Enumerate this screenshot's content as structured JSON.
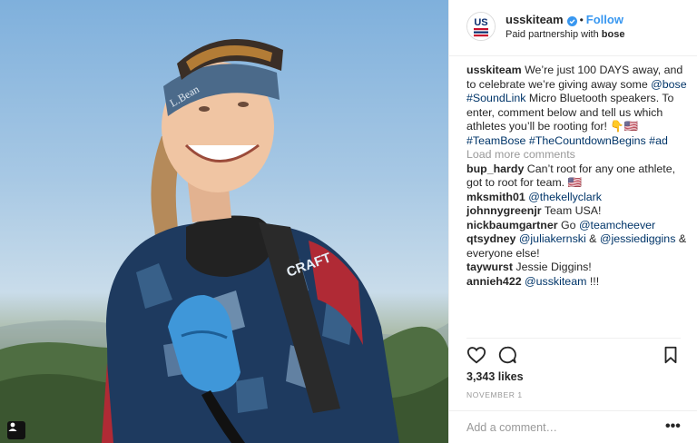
{
  "photo": {
    "alt_icon": "user-tag-icon",
    "headband_text": "L.Bean",
    "jacket_text": "CRAFT"
  },
  "header": {
    "username": "usskiteam",
    "verified_icon": "verified-badge-icon",
    "separator": "•",
    "follow_label": "Follow",
    "partner_prefix": "Paid partnership with ",
    "partner_name": "bose",
    "avatar_text": "US"
  },
  "caption": {
    "username": "usskiteam",
    "text_1": " We’re just 100 DAYS away, and to celebrate we’re giving away some ",
    "mention_1": "@bose",
    "space_1": " ",
    "hashtag_1": "#SoundLink",
    "text_2": " Micro Bluetooth speakers. To enter, comment below and tell us which athletes you’ll be rooting for! ",
    "emoji": "👇🇺🇸",
    "hashtag_2": "#TeamBose",
    "space_2": " ",
    "hashtag_3": "#TheCountdownBegins",
    "space_3": " ",
    "hashtag_4": "#ad"
  },
  "load_more": "Load more comments",
  "comments": [
    {
      "user": "bup_hardy",
      "text": " Can’t root for any one athlete, got to root for team. 🇺🇸"
    },
    {
      "user": "mksmith01",
      "mention": " @thekellyclark"
    },
    {
      "user": "johnnygreenjr",
      "text": " Team USA!"
    },
    {
      "user": "nickbaumgartner",
      "text": " Go ",
      "mention": "@teamcheever"
    },
    {
      "user": "qtsydney",
      "mention": " @juliakernski",
      "text": " & ",
      "mention2": "@jessiediggins",
      "text2": " & everyone else!"
    },
    {
      "user": "taywurst",
      "text": " Jessie Diggins!"
    },
    {
      "user": "annieh422",
      "mention": " @usskiteam",
      "text": " !!!"
    }
  ],
  "actions": {
    "like_icon": "heart-icon",
    "comment_icon": "comment-bubble-icon",
    "save_icon": "bookmark-icon"
  },
  "likes": "3,343 likes",
  "date": "NOVEMBER 1",
  "add_comment": {
    "placeholder": "Add a comment…",
    "more_label": "•••",
    "more_icon": "more-options-icon"
  }
}
